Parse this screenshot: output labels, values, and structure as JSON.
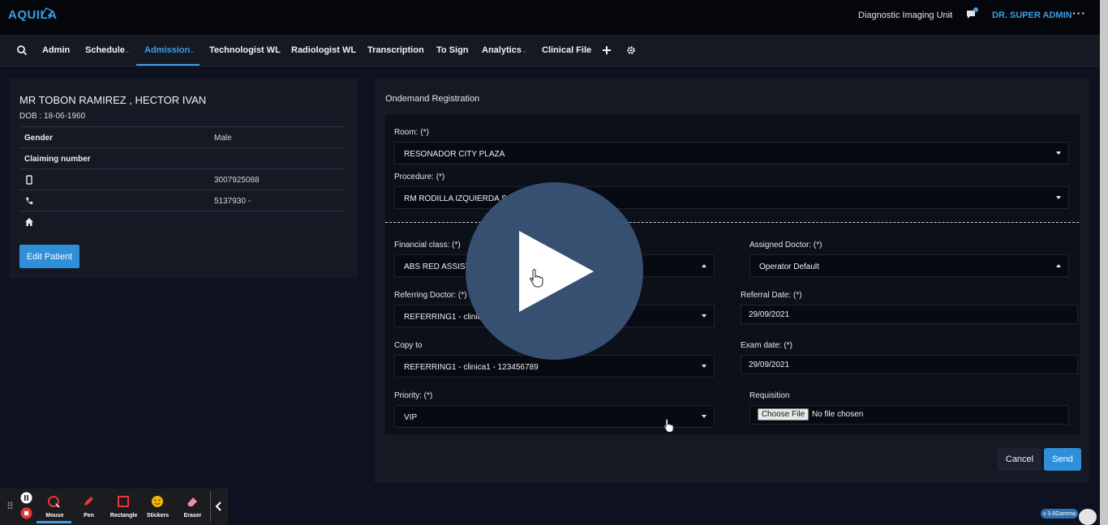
{
  "header": {
    "logo": "AQUILA",
    "unit": "Diagnostic Imaging Unit",
    "user": "DR. SUPER ADMIN"
  },
  "nav": {
    "items": [
      {
        "label": "Admin"
      },
      {
        "label": "Schedule"
      },
      {
        "label": "Admission"
      },
      {
        "label": "Technologist WL"
      },
      {
        "label": "Radiologist WL"
      },
      {
        "label": "Transcription"
      },
      {
        "label": "To Sign"
      },
      {
        "label": "Analytics"
      },
      {
        "label": "Clinical File"
      }
    ]
  },
  "patient": {
    "name": "MR TOBON RAMIREZ , HECTOR IVAN",
    "dob": "DOB : 18-06-1960",
    "rows": {
      "gender_label": "Gender",
      "gender_value": "Male",
      "claiming_label": "Claiming number",
      "mobile_value": "3007925088",
      "phone_value": "5137930 -"
    },
    "edit_button": "Edit Patient"
  },
  "form": {
    "title": "Ondemand Registration",
    "room_label": "Room: (*)",
    "room_value": "RESONADOR CITY PLAZA",
    "procedure_label": "Procedure: (*)",
    "procedure_value": "RM RODILLA IZQUIERDA S",
    "financial_label": "Financial class: (*)",
    "financial_value": "ABS RED ASSIST",
    "assigned_label": "Assigned Doctor: (*)",
    "assigned_value": "Operator Default",
    "referring_label": "Referring Doctor: (*)",
    "referring_value": "REFERRING1 - clinic",
    "referral_date_label": "Referral Date: (*)",
    "referral_date_value": "29/09/2021",
    "copy_label": "Copy to",
    "copy_value": "REFERRING1 - clinica1 - 123456789",
    "exam_date_label": "Exam date: (*)",
    "exam_date_value": "29/09/2021",
    "priority_label": "Priority: (*)",
    "priority_value": "VIP",
    "requisition_label": "Requisition",
    "choose_file": "Choose File",
    "no_file": "No file chosen",
    "cancel": "Cancel",
    "send": "Send"
  },
  "recorder": {
    "tools": [
      "Mouse",
      "Pen",
      "Rectangle",
      "Stickers",
      "Eraser"
    ]
  },
  "version": "v 3.6Gamma"
}
